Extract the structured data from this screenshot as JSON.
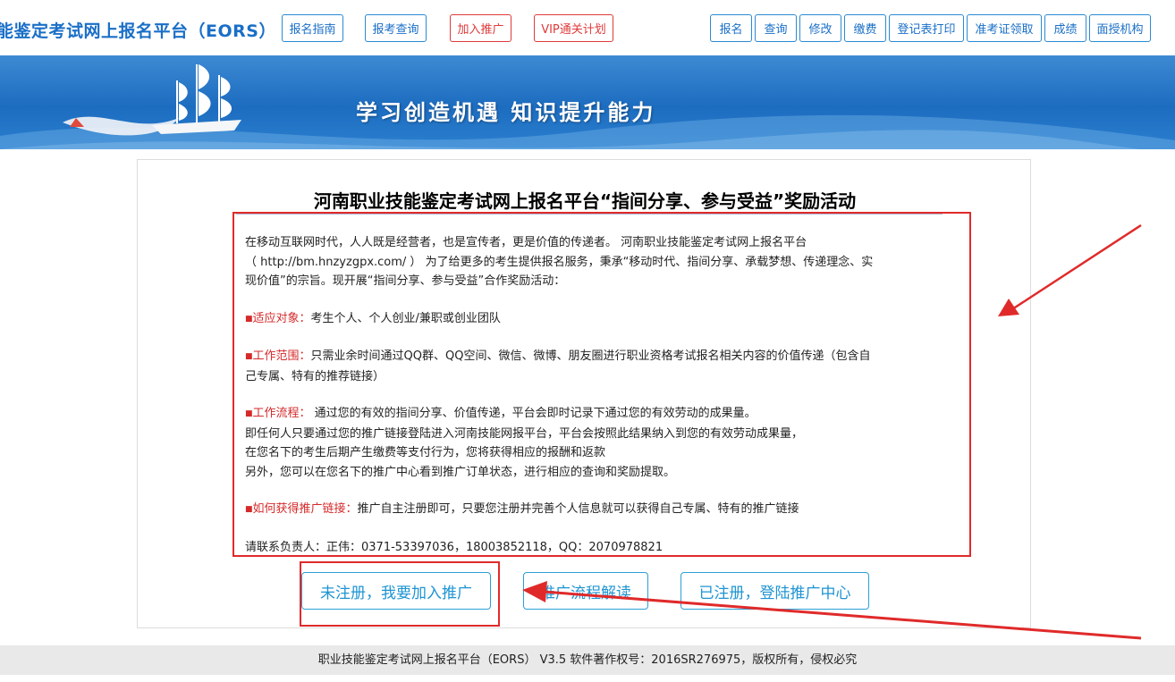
{
  "header": {
    "site_title": "能鉴定考试网上报名平台（EORS）",
    "nav_left": [
      "报名指南",
      "报考查询",
      "加入推广",
      "VIP通关计划"
    ],
    "nav_right": [
      "报名",
      "查询",
      "修改",
      "缴费",
      "登记表打印",
      "准考证领取",
      "成绩",
      "面授机构"
    ]
  },
  "banner": {
    "slogan": "学习创造机遇  知识提升能力"
  },
  "panel": {
    "title": "河南职业技能鉴定考试网上报名平台“指间分享、参与受益”奖励活动",
    "intro": [
      "在移动互联网时代，人人既是经营者，也是宣传者，更是价值的传递者。 河南职业技能鉴定考试网上报名平台",
      "（ http://bm.hnzyzgpx.com/ ） 为了给更多的考生提供报名服务，秉承“移动时代、指间分享、承载梦想、传递理念、实",
      "现价值”的宗旨。现开展“指间分享、参与受益”合作奖励活动："
    ],
    "target_label": "适应对象：",
    "target_text": "考生个人、个人创业/兼职或创业团队",
    "scope_label": "工作范围：",
    "scope_lines": [
      "只需业余时间通过QQ群、QQ空间、微信、微博、朋友圈进行职业资格考试报名相关内容的价值传递（包含自",
      "己专属、特有的推荐链接）"
    ],
    "process_label": "工作流程：",
    "process_lines": [
      " 通过您的有效的指间分享、价值传递，平台会即时记录下通过您的有效劳动的成果量。",
      "即任何人只要通过您的推广链接登陆进入河南技能网报平台，平台会按照此结果纳入到您的有效劳动成果量，",
      "在您名下的考生后期产生缴费等支付行为，您将获得相应的报酬和返款",
      "另外，您可以在您名下的推广中心看到推广订单状态，进行相应的查询和奖励提取。"
    ],
    "howto_label": "如何获得推广链接：",
    "howto_text": "推广自主注册即可，只要您注册并完善个人信息就可以获得自己专属、特有的推广链接",
    "contact": "请联系负责人：正伟：0371-53397036，18003852118，QQ：2070978821",
    "buttons": [
      "未注册，我要加入推广",
      "推广流程解读",
      "已注册，登陆推广中心"
    ]
  },
  "footer": {
    "text": "职业技能鉴定考试网上报名平台（EORS） V3.5 软件著作权号：2016SR276975，版权所有，侵权必究"
  },
  "colors": {
    "accent": "#1a6fc7",
    "highlight_red": "#e02a2a",
    "banner_blue": "#1c6cc0"
  }
}
